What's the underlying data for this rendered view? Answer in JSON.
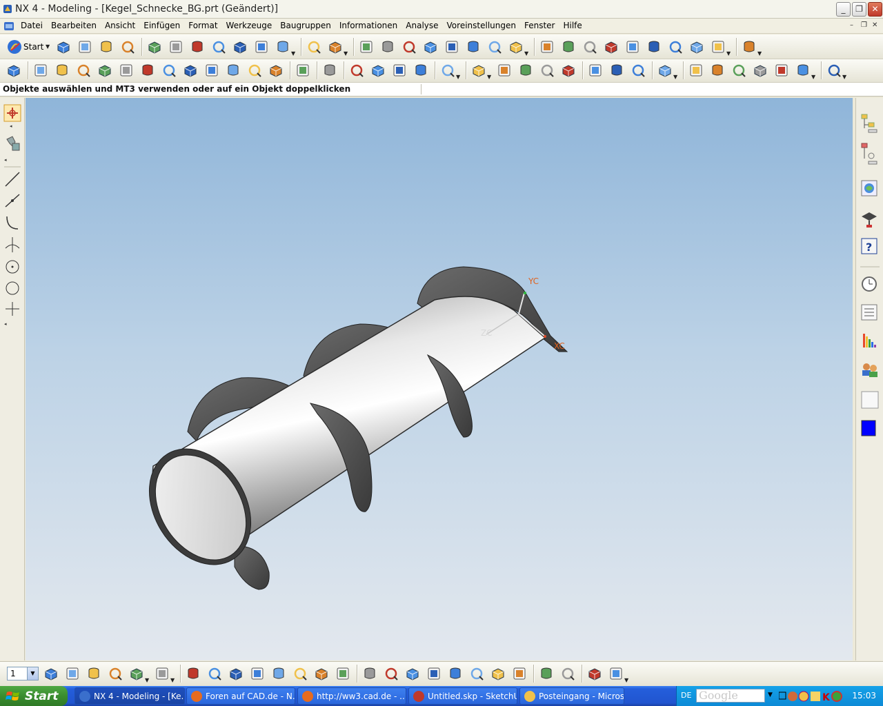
{
  "window": {
    "title": "NX 4 - Modeling - [Kegel_Schnecke_BG.prt (Geändert)]",
    "controls": {
      "minimize": "_",
      "restore": "❐",
      "close": "✕"
    }
  },
  "menubar": {
    "items": [
      "Datei",
      "Bearbeiten",
      "Ansicht",
      "Einfügen",
      "Format",
      "Werkzeuge",
      "Baugruppen",
      "Informationen",
      "Analyse",
      "Voreinstellungen",
      "Fenster",
      "Hilfe"
    ],
    "doc_controls": {
      "minimize": "–",
      "restore": "❐",
      "close": "✕"
    }
  },
  "toolbar": {
    "start_label": "Start",
    "tb1_icons": [
      "new-file",
      "open-folder",
      "save",
      "print",
      "cut",
      "copy",
      "paste",
      "delete",
      "undo",
      "properties",
      "info",
      "measure",
      "ruler",
      "fit-view",
      "zoom-window",
      "zoom",
      "zoom-in",
      "rotate",
      "pan",
      "wcs",
      "view-iso",
      "view-shaded",
      "view-top",
      "view-front",
      "view-right",
      "view-wireframe",
      "view-hidden",
      "view-iso2",
      "render-style",
      "assembly-nav",
      "layout"
    ],
    "tb2_icons": [
      "sketch",
      "extrude",
      "revolve",
      "sweep",
      "tube",
      "block",
      "cylinder-solid",
      "cone-solid",
      "sphere-solid",
      "hole",
      "boss",
      "pad",
      "pocket",
      "datum-axis",
      "datum-plane",
      "cylinder",
      "cone",
      "sphere",
      "sheet",
      "blend",
      "chamfer",
      "shell",
      "thicken",
      "thread",
      "offset",
      "trim",
      "split",
      "pattern",
      "mirror",
      "drafting",
      "table",
      "parts-list",
      "grid",
      "tabular",
      "delete-table",
      "color-palette"
    ]
  },
  "cue_line": {
    "text": "Objekte auswählen und MT3 verwenden oder auf ein Objekt doppelklicken"
  },
  "left_toolbar": {
    "icons": [
      "select",
      "select-filter",
      "line",
      "line-point",
      "arc",
      "axis",
      "circle-point",
      "circle",
      "point"
    ]
  },
  "right_toolbar": {
    "icons": [
      "assembly-navigator",
      "part-navigator",
      "web-browser",
      "training",
      "help",
      "history",
      "reuse-library",
      "system-materials",
      "roles",
      "palette",
      "color-blue"
    ]
  },
  "viewport": {
    "axis_labels": {
      "yc": "YC",
      "zc": "ZC",
      "xc": "XC"
    },
    "colors": {
      "bg_top": "#8fb5d9",
      "bg_bottom": "#e3e8ee",
      "axis_label": "#e0621e"
    }
  },
  "bottom_toolbar": {
    "layer_value": "1",
    "icons": [
      "layer-settings",
      "layer-visible",
      "layer-category",
      "move-layer",
      "copy-layer",
      "layer-wcs",
      "snap-point",
      "snap-end",
      "snap-mid",
      "snap-control",
      "snap-intersect",
      "snap-center",
      "snap-quadrant",
      "snap-existing",
      "assembly-constraint",
      "mate",
      "add-component",
      "mirror-assembly",
      "reposition",
      "replace",
      "explode",
      "sequence",
      "wave",
      "link",
      "reference-set",
      "clone"
    ]
  },
  "taskbar": {
    "start_label": "Start",
    "tasks": [
      {
        "label": "NX 4 - Modeling - [Ke...",
        "active": true
      },
      {
        "label": "Foren auf CAD.de - N...",
        "active": false
      },
      {
        "label": "http://ww3.cad.de - ...",
        "active": false
      },
      {
        "label": "Untitled.skp - SketchUp",
        "active": false
      },
      {
        "label": "Posteingang - Micros...",
        "active": false
      }
    ],
    "tray": {
      "lang": "DE",
      "search_text": "Google",
      "clock": "15:03"
    }
  }
}
